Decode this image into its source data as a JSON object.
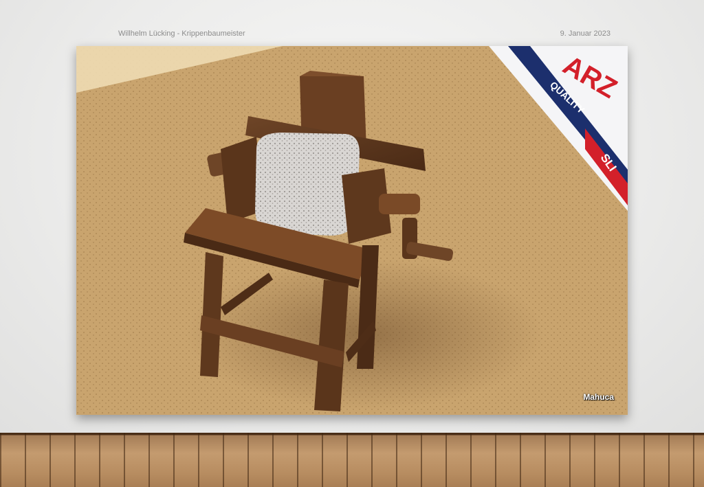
{
  "slide": {
    "header_left": "Willhelm Lücking - Krippenbaumeister",
    "header_right": "9. Januar 2023"
  },
  "photo": {
    "watermark": "Mahuca",
    "box_text": {
      "brand": "ARZ",
      "quality": "QUALITY",
      "sli": "SLI"
    }
  }
}
